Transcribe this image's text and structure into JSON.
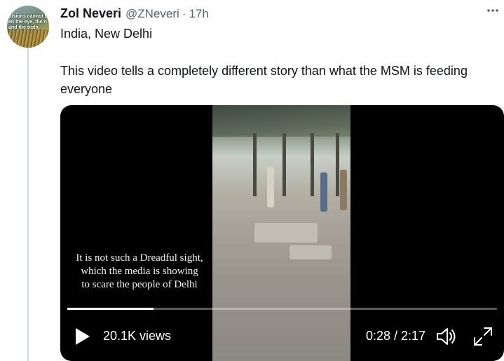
{
  "tweet": {
    "avatar_text": [
      "Visions cannot be",
      "en the eye, the n",
      "and the truth."
    ],
    "display_name": "Zol Neveri",
    "handle": "@ZNeveri",
    "separator": "·",
    "time": "17h",
    "more_icon": "more-horizontal-icon",
    "location": "India, New Delhi",
    "text": "This video tells a completely different story than what the MSM is feeding everyone"
  },
  "video": {
    "caption": [
      "It is not such a Dreadful sight,",
      "which the media is showing",
      "to scare the people of Delhi"
    ],
    "progress": 0.2,
    "views": "20.1K views",
    "timecode": "0:28 / 2:17",
    "icons": [
      "play-icon",
      "volume-icon",
      "fullscreen-icon"
    ]
  },
  "colors": {
    "text": "#0f1419",
    "secondary": "#536471",
    "video_bg": "#000000",
    "thread_line": "#cfd9de"
  }
}
